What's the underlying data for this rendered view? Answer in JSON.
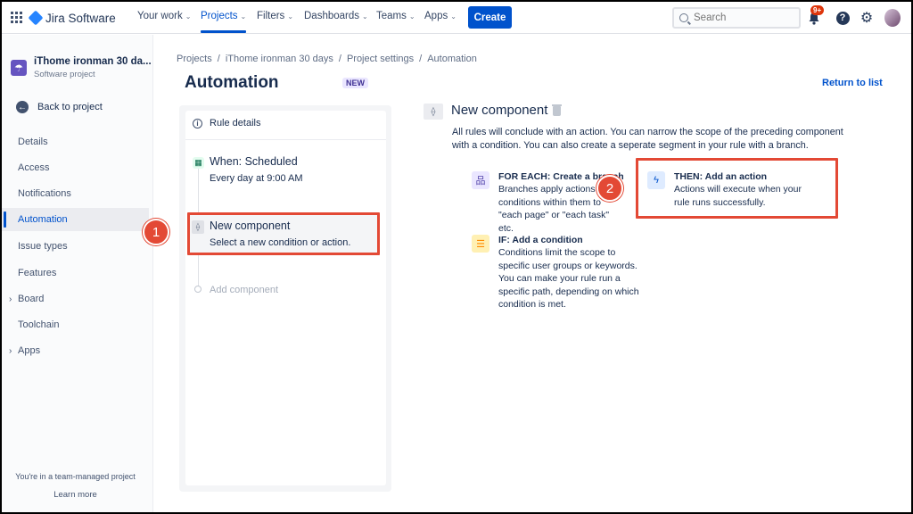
{
  "topnav": {
    "product": "Jira Software",
    "items": [
      {
        "label": "Your work",
        "active": false
      },
      {
        "label": "Projects",
        "active": true
      },
      {
        "label": "Filters",
        "active": false
      },
      {
        "label": "Dashboards",
        "active": false
      },
      {
        "label": "Teams",
        "active": false
      },
      {
        "label": "Apps",
        "active": false
      }
    ],
    "create_label": "Create",
    "search_placeholder": "Search",
    "notification_badge": "9+",
    "help_label": "?"
  },
  "sidebar": {
    "project_name": "iThome ironman 30 da...",
    "project_type": "Software project",
    "back_label": "Back to project",
    "items": [
      {
        "label": "Details"
      },
      {
        "label": "Access"
      },
      {
        "label": "Notifications"
      },
      {
        "label": "Automation",
        "active": true
      },
      {
        "label": "Issue types"
      },
      {
        "label": "Features"
      },
      {
        "label": "Board",
        "expandable": true
      },
      {
        "label": "Toolchain"
      },
      {
        "label": "Apps",
        "expandable": true
      }
    ],
    "footer_text": "You're in a team-managed project",
    "footer_link": "Learn more"
  },
  "main": {
    "breadcrumb": [
      "Projects",
      "iThome ironman 30 days",
      "Project settings",
      "Automation"
    ],
    "breadcrumb_sep": "/",
    "title": "Automation",
    "new_badge": "NEW",
    "return_link": "Return to list"
  },
  "rule": {
    "details_label": "Rule details",
    "trigger_title": "When: Scheduled",
    "trigger_sub": "Every day at 9:00 AM",
    "component_title": "New component",
    "component_sub": "Select a new condition or action.",
    "add_component": "Add component"
  },
  "steps": {
    "one": "1",
    "two": "2"
  },
  "component_panel": {
    "title": "New component",
    "description": "All rules will conclude with an action. You can narrow the scope of the preceding component with a condition. You can also create a seperate segment in your rule with a branch.",
    "options": {
      "foreach": {
        "title": "FOR EACH: Create a branch",
        "body": "Branches apply actions to conditions within them to \"each page\" or \"each task\" etc.",
        "icon": "branch-icon"
      },
      "if": {
        "title": "IF: Add a condition",
        "body": "Conditions limit the scope to specific user groups or keywords. You can make your rule run a specific path, depending on which condition is met.",
        "icon": "filter-icon"
      },
      "then": {
        "title": "THEN: Add an action",
        "body": "Actions will execute when your rule runs successfully.",
        "icon": "lightning-icon"
      }
    }
  },
  "colors": {
    "brand": "#0052cc",
    "highlight": "#e34935"
  }
}
